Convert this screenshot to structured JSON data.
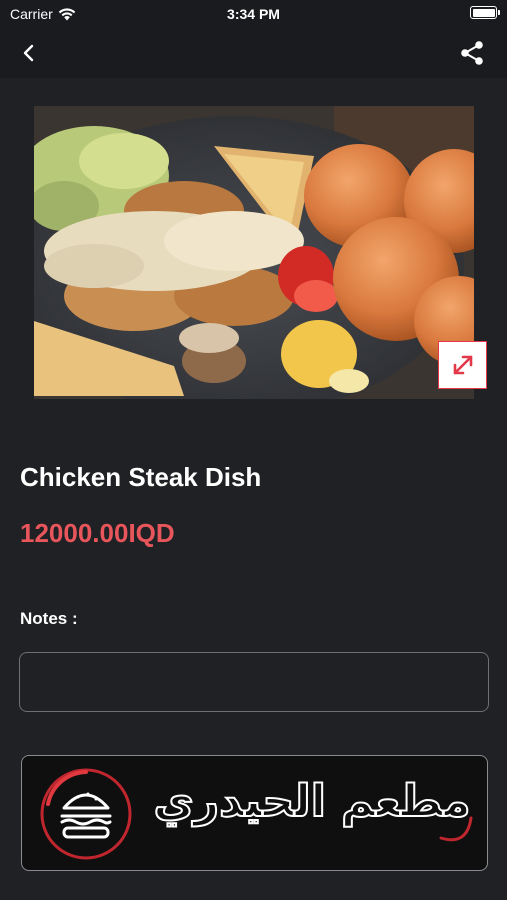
{
  "status_bar": {
    "carrier": "Carrier",
    "time": "3:34 PM"
  },
  "nav": {
    "back_icon": "chevron-left-icon",
    "share_icon": "share-icon"
  },
  "product": {
    "image_alt": "Chicken Steak Dish",
    "title": "Chicken Steak Dish",
    "price": "12000.00IQD"
  },
  "notes": {
    "label": "Notes :",
    "value": "",
    "placeholder": ""
  },
  "restaurant_logo": {
    "text": "مطعم الحيدري"
  },
  "colors": {
    "background": "#202124",
    "bar": "#1a1b1e",
    "price": "#e8565b",
    "accent_red": "#e2384a"
  }
}
